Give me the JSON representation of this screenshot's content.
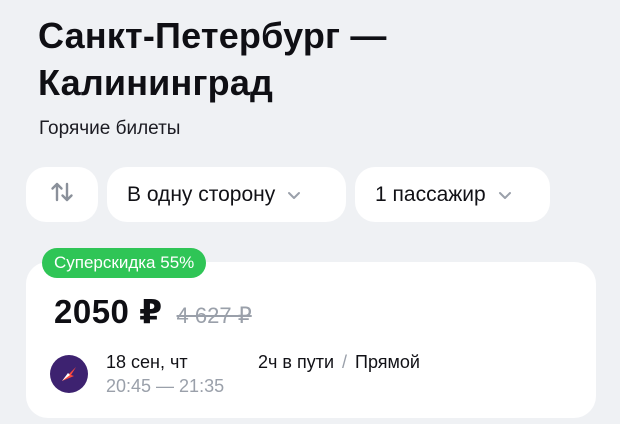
{
  "header": {
    "title_line1": "Санкт-Петербург —",
    "title_line2": "Калининград",
    "subtitle": "Горячие билеты"
  },
  "filters": {
    "swap_icon": "swap-vertical-arrows-icon",
    "direction_label": "В одну сторону",
    "passengers_label": "1 пассажир",
    "chevron_icon": "chevron-down-icon"
  },
  "ticket": {
    "badge": "Суперскидка 55%",
    "price": "2050 ₽",
    "old_price": "4 627 ₽",
    "date": "18 сен, чт",
    "times": "20:45 — 21:35",
    "duration": "2ч в пути",
    "separator": "/",
    "flight_type": "Прямой",
    "airline_icon": "airline-logo-icon"
  },
  "colors": {
    "background": "#eff1f4",
    "badge": "#2fc556",
    "muted_text": "#9aa0aa",
    "airline_logo_bg": "#3d2270",
    "airline_logo_accent": "#ff4a3d"
  }
}
